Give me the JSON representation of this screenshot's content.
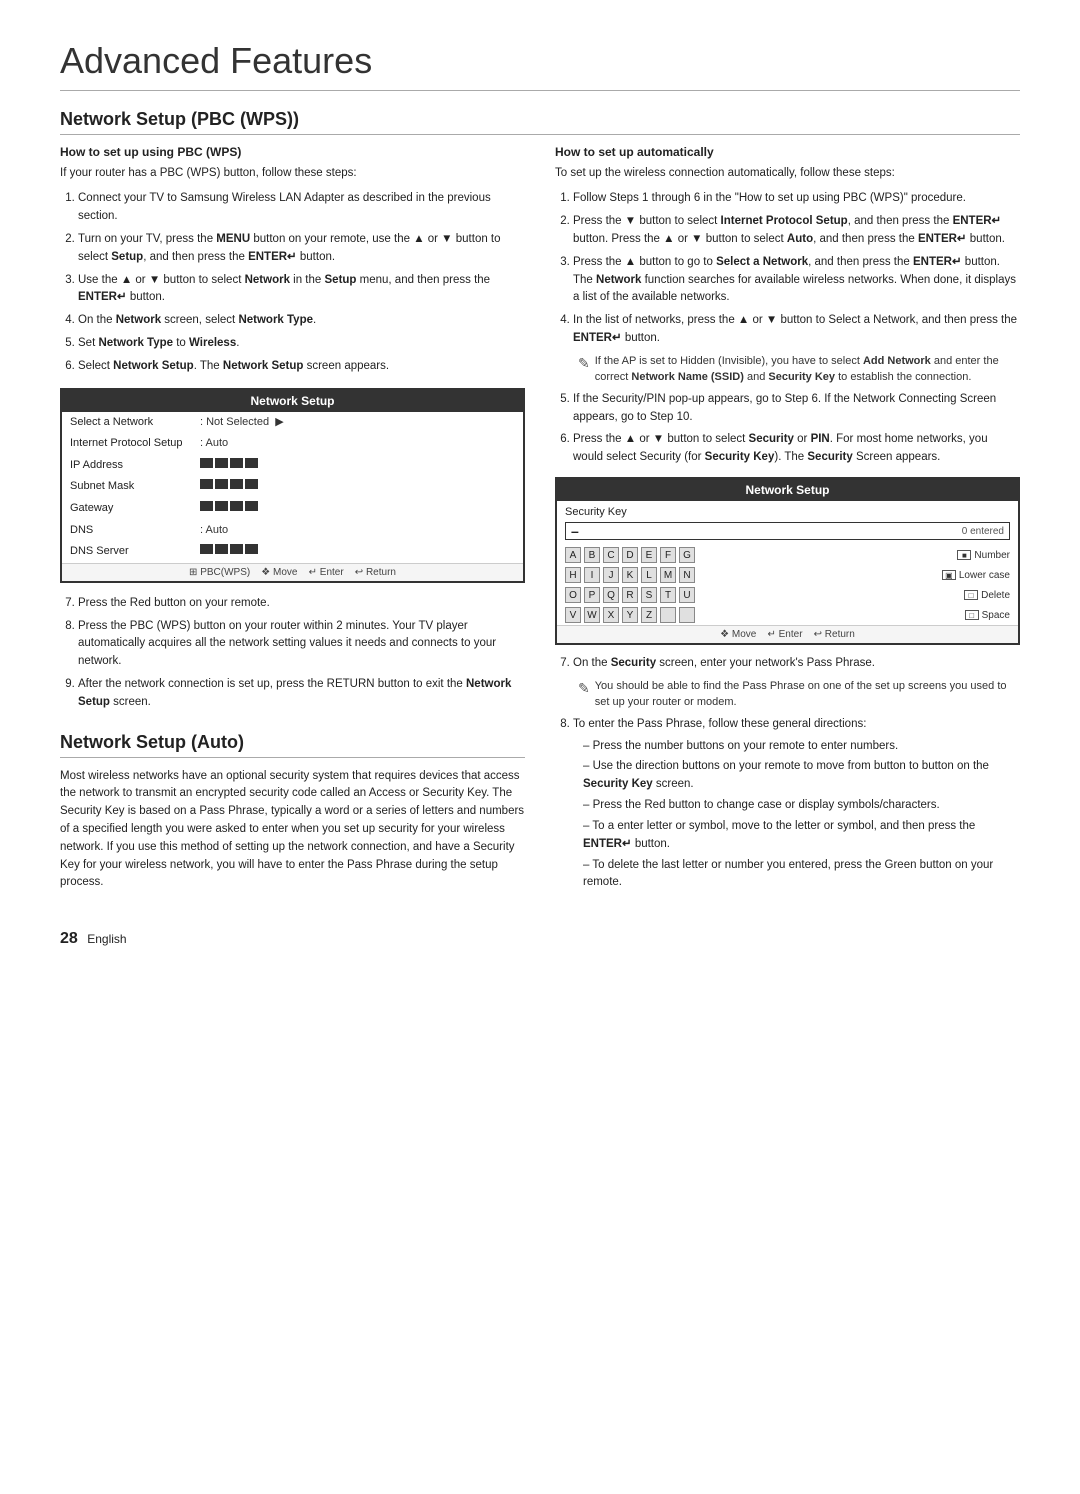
{
  "page": {
    "title": "Advanced Features",
    "page_number": "28",
    "page_lang": "English"
  },
  "section_pbc": {
    "title": "Network Setup (PBC (WPS))",
    "subsection_pbc": {
      "title": "How to set up using PBC (WPS)",
      "intro": "If your router has a PBC (WPS) button, follow these steps:",
      "steps": [
        "Connect your TV to Samsung Wireless LAN Adapter as described in the previous section.",
        "Turn on your TV, press the MENU button on your remote, use the ▲ or ▼ button to select Setup, and then press the ENTER↵ button.",
        "Use the ▲ or ▼ button to select Network in the Setup menu, and then press the ENTER↵ button.",
        "On the Network screen, select Network Type.",
        "Set Network Type to Wireless.",
        "Select Network Setup. The Network Setup screen appears."
      ],
      "network_setup_box": {
        "header": "Network Setup",
        "rows": [
          {
            "label": "Select a Network",
            "value": ": Not Selected  ▶"
          },
          {
            "label": "Internet Protocol Setup",
            "value": ": Auto"
          },
          {
            "label": "IP Address",
            "value": "blocks"
          },
          {
            "label": "Subnet Mask",
            "value": "blocks"
          },
          {
            "label": "Gateway",
            "value": "blocks"
          },
          {
            "label": "DNS",
            "value": ": Auto"
          },
          {
            "label": "DNS Server",
            "value": "blocks"
          }
        ],
        "footer": "⊞ PBC(WPS)  ❖ Move  ↵ Enter  ↩ Return"
      },
      "steps_after": [
        "Press the Red button on your remote.",
        "Press the PBC (WPS) button on your router within 2 minutes. Your TV player automatically acquires all the network setting values it needs and connects to your network.",
        "After the network connection is set up, press the RETURN button to exit the Network Setup screen."
      ]
    }
  },
  "section_auto": {
    "title": "Network Setup (Auto)",
    "intro": "Most wireless networks have an optional security system that requires devices that access the network to transmit an encrypted security code called an Access or Security Key. The Security Key is based on a Pass Phrase, typically a word or a series of letters and numbers of a specified length you were asked to enter when you set up security for your wireless network.  If you use this method of setting up the network connection, and have a Security Key for your wireless network, you will have to enter the Pass Phrase during the setup process."
  },
  "col_right": {
    "subsection_auto": {
      "title": "How to set up automatically",
      "intro": "To set up the wireless connection automatically, follow these steps:",
      "steps": [
        "Follow Steps 1 through 6 in the \"How to set up using PBC (WPS)\" procedure.",
        "Press the ▼ button to select Internet Protocol Setup, and then press the ENTER↵ button. Press the ▲ or ▼ button to select Auto, and then press the ENTER↵ button.",
        "Press the ▲ button to go to Select a Network, and then press the ENTER↵ button. The Network function searches for available wireless networks. When done, it displays a list of the available networks.",
        "In the list of networks, press the ▲ or ▼ button to Select a Network, and then press the ENTER↵ button.",
        "If the Security/PIN pop-up appears, go to Step 6. If the Network Connecting Screen appears, go to Step 10.",
        "Press the ▲ or ▼ button to select Security or PIN. For most home networks, you would select Security (for Security Key). The Security Screen appears."
      ],
      "note_hidden": "If the AP is set to Hidden (Invisible), you have to select Add Network and enter the correct Network Name (SSID) and Security Key to establish the connection.",
      "security_box": {
        "header": "Network Setup",
        "key_label": "Security Key",
        "dash": "–",
        "count": "0 entered",
        "keyboard_rows": [
          {
            "keys": [
              "A",
              "B",
              "C",
              "D",
              "E",
              "F",
              "G"
            ],
            "action_icon": "⬛",
            "action_label": "Number"
          },
          {
            "keys": [
              "H",
              "I",
              "J",
              "K",
              "L",
              "M",
              "N"
            ],
            "action_icon": "▣",
            "action_label": "Lower case"
          },
          {
            "keys": [
              "O",
              "P",
              "Q",
              "R",
              "S",
              "T",
              "U"
            ],
            "action_icon": "□",
            "action_label": "Delete"
          },
          {
            "keys": [
              "V",
              "W",
              "X",
              "Y",
              "Z",
              "",
              ""
            ],
            "action_icon": "□",
            "action_label": "Space"
          }
        ],
        "footer": "❖ Move  ↵ Enter  ↩ Return"
      },
      "steps_after": [
        "On the Security screen, enter your network's Pass Phrase.",
        "To enter the Pass Phrase, follow these general directions:"
      ],
      "note_passphrase": "You should be able to find the Pass Phrase on one of the set up screens you used to set up your router or modem.",
      "directions": [
        "Press the number buttons on your remote to enter numbers.",
        "Use the direction buttons on your remote to move from button to button on the Security Key screen.",
        "Press the Red button to change case or display symbols/characters.",
        "To a enter letter or symbol, move to the letter or symbol, and then press the ENTER↵ button.",
        "To delete the last letter or number you entered, press the Green button on your remote."
      ]
    }
  }
}
